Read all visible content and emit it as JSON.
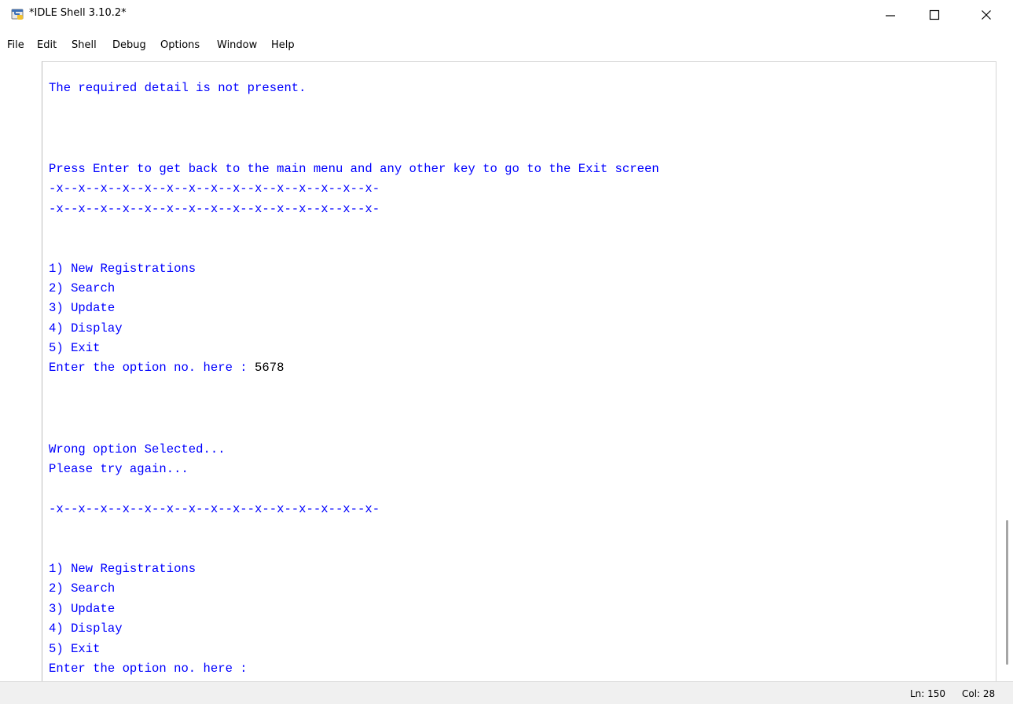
{
  "window": {
    "title": "*IDLE Shell 3.10.2*",
    "icon": "python-idle-icon",
    "controls": [
      "minimize-icon",
      "maximize-icon",
      "close-icon"
    ]
  },
  "menu": [
    "File",
    "Edit",
    "Shell",
    "Debug",
    "Options",
    "Window",
    "Help"
  ],
  "shell": {
    "lines": [
      {
        "text": "The required detail is not present."
      },
      {
        "text": "Press Enter to get back to the main menu and any other key to go to the Exit screen"
      },
      {
        "text": "-x--x--x--x--x--x--x--x--x--x--x--x--x--x--x-"
      },
      {
        "text": "-x--x--x--x--x--x--x--x--x--x--x--x--x--x--x-"
      },
      {
        "text": "1) New Registrations"
      },
      {
        "text": "2) Search"
      },
      {
        "text": "3) Update"
      },
      {
        "text": "4) Display"
      },
      {
        "text": "5) Exit"
      },
      {
        "text": "Enter the option no. here : ",
        "input": "5678"
      },
      {
        "text": "Wrong option Selected..."
      },
      {
        "text": "Please try again..."
      },
      {
        "text": "-x--x--x--x--x--x--x--x--x--x--x--x--x--x--x-"
      },
      {
        "text": "1) New Registrations"
      },
      {
        "text": "2) Search"
      },
      {
        "text": "3) Update"
      },
      {
        "text": "4) Display"
      },
      {
        "text": "5) Exit"
      },
      {
        "text": "Enter the option no. here :"
      }
    ],
    "text_color": "#0000ff",
    "input_color": "#000000"
  },
  "status": {
    "ln": "Ln: 150",
    "col": "Col: 28"
  }
}
